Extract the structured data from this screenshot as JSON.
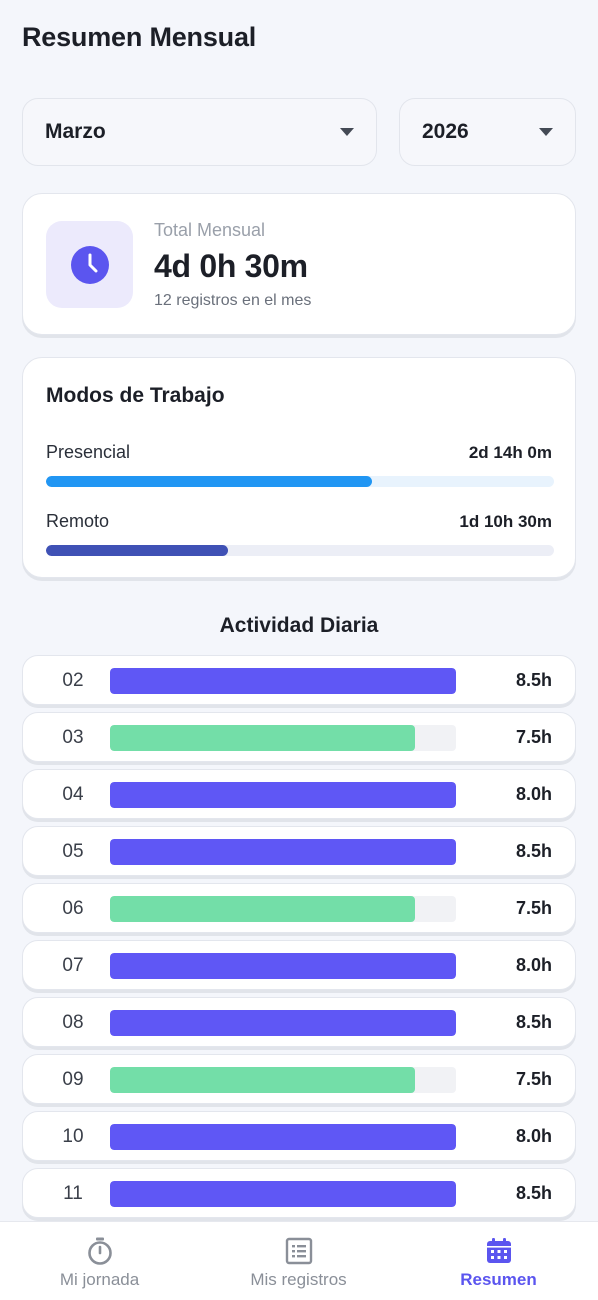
{
  "header": {
    "title": "Resumen Mensual"
  },
  "filters": {
    "month": "Marzo",
    "year": "2026"
  },
  "total": {
    "label": "Total Mensual",
    "value": "4d 0h 30m",
    "subtitle": "12 registros en el mes"
  },
  "modes": {
    "title": "Modos de Trabajo",
    "items": [
      {
        "label": "Presencial",
        "value": "2d 14h 0m",
        "fraction": 0.642,
        "color": "#2196f3",
        "track": "#e8f3fd"
      },
      {
        "label": "Remoto",
        "value": "1d 10h 30m",
        "fraction": 0.358,
        "color": "#3f51b5",
        "track": "#eceef6"
      }
    ]
  },
  "activity": {
    "title": "Actividad Diaria",
    "max_hours": 8.5,
    "days": [
      {
        "day": "02",
        "hours_label": "8.5h",
        "hours": 8.5,
        "color": "#5f57f5"
      },
      {
        "day": "03",
        "hours_label": "7.5h",
        "hours": 7.5,
        "color": "#73dea8"
      },
      {
        "day": "04",
        "hours_label": "8.0h",
        "hours": 8.5,
        "color": "#5f57f5"
      },
      {
        "day": "05",
        "hours_label": "8.5h",
        "hours": 8.5,
        "color": "#5f57f5"
      },
      {
        "day": "06",
        "hours_label": "7.5h",
        "hours": 7.5,
        "color": "#73dea8"
      },
      {
        "day": "07",
        "hours_label": "8.0h",
        "hours": 8.5,
        "color": "#5f57f5"
      },
      {
        "day": "08",
        "hours_label": "8.5h",
        "hours": 8.5,
        "color": "#5f57f5"
      },
      {
        "day": "09",
        "hours_label": "7.5h",
        "hours": 7.5,
        "color": "#73dea8"
      },
      {
        "day": "10",
        "hours_label": "8.0h",
        "hours": 8.5,
        "color": "#5f57f5"
      },
      {
        "day": "11",
        "hours_label": "8.5h",
        "hours": 8.5,
        "color": "#5f57f5"
      }
    ]
  },
  "nav": {
    "items": [
      {
        "label": "Mi jornada",
        "icon": "stopwatch-icon",
        "active": false
      },
      {
        "label": "Mis registros",
        "icon": "list-icon",
        "active": false
      },
      {
        "label": "Resumen",
        "icon": "calendar-icon",
        "active": true
      }
    ],
    "active_color": "#5b55ef",
    "inactive_color": "#8a8f98"
  },
  "colors": {
    "accent": "#5b55ef",
    "clock_bg": "#eceafc"
  }
}
